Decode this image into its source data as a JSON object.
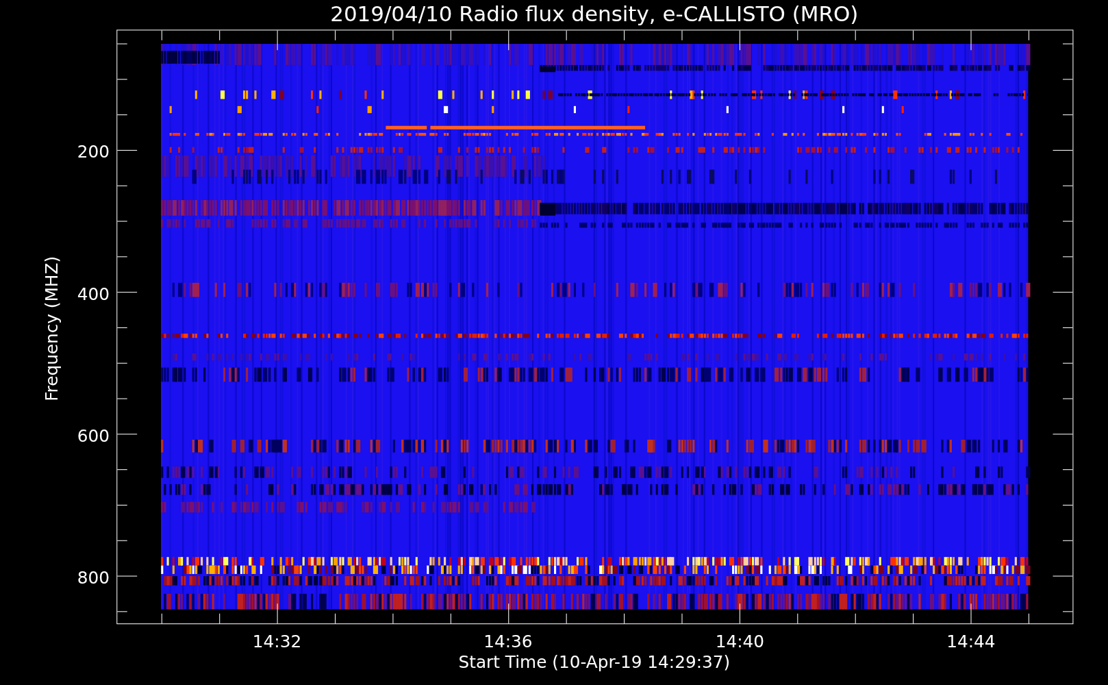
{
  "title": "2019/04/10  Radio flux density, e-CALLISTO (MRO)",
  "y_axis": {
    "label": "Frequency (MHZ)",
    "ticks": [
      "200",
      "400",
      "600",
      "800"
    ]
  },
  "x_axis": {
    "label": "Start Time (10-Apr-19 14:29:37)",
    "ticks": [
      "14:32",
      "14:36",
      "14:40",
      "14:44"
    ]
  }
}
